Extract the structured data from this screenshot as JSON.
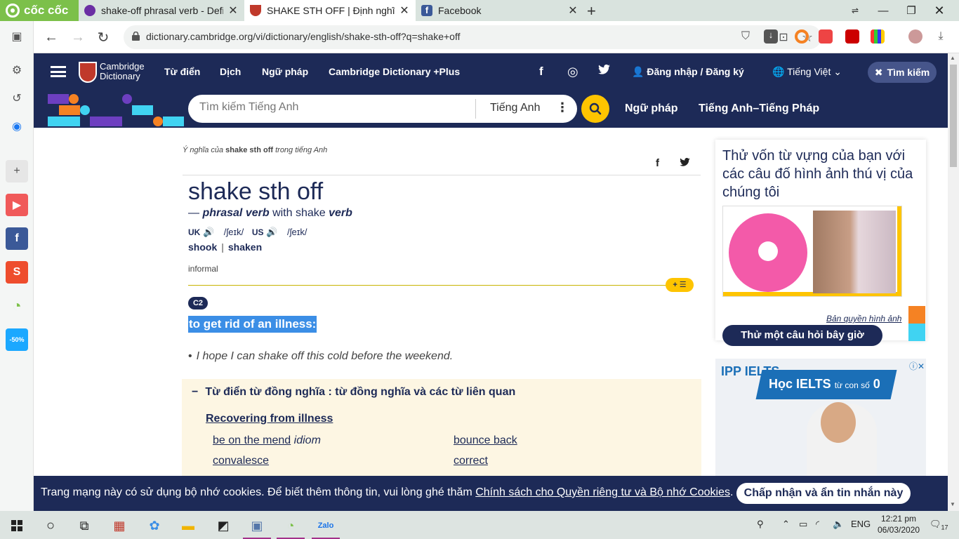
{
  "browser": {
    "brand": "cốc cốc",
    "tabs": [
      {
        "label": "shake-off phrasal verb - Defin",
        "icon": "purple-circle-icon",
        "color": "#6b2ea3"
      },
      {
        "label": "SHAKE STH OFF | Định nghĩa",
        "icon": "cambridge-crest-icon",
        "color": "#c0392b"
      },
      {
        "label": "Facebook",
        "icon": "facebook-icon",
        "color": "#3b5998"
      }
    ],
    "new_tab": "+",
    "url": "dictionary.cambridge.org/vi/dictionary/english/shake-sth-off?q=shake+off"
  },
  "site": {
    "brand_line1": "Cambridge",
    "brand_line2": "Dictionary",
    "nav": [
      "Từ điển",
      "Dịch",
      "Ngữ pháp",
      "Cambridge Dictionary +Plus"
    ],
    "social": {
      "facebook": "f",
      "instagram": "◎",
      "twitter": "🐦"
    },
    "login": "Đăng nhập / Đăng ký",
    "language": "Tiếng Việt",
    "close_search": "Tìm kiếm",
    "search_placeholder": "Tìm kiếm Tiếng Anh",
    "search_lang": "Tiếng Anh",
    "subnav": [
      "Ngữ pháp",
      "Tiếng Anh–Tiếng Pháp"
    ]
  },
  "entry": {
    "breadcrumb_prefix": "Ý nghĩa của",
    "breadcrumb_word": "shake sth off",
    "breadcrumb_suffix": "trong tiếng Anh",
    "headword": "shake sth off",
    "pos_dash": "—",
    "pos": "phrasal verb",
    "pos_with": "with shake",
    "pos_verb": "verb",
    "uk_label": "UK",
    "uk_ipa": "/ʃeɪk/",
    "us_label": "US",
    "us_ipa": "/ʃeɪk/",
    "form1": "shook",
    "form_sep": "|",
    "form2": "shaken",
    "register": "informal",
    "plus_label": "+ ☰",
    "level": "C2",
    "definition": "to get rid of an illness:",
    "example": "I hope I can shake off this cold before the weekend."
  },
  "thesaurus": {
    "title": "Từ điển từ đồng nghĩa : từ đồng nghĩa và các từ liên quan",
    "subtitle": "Recovering from illness",
    "items": [
      {
        "word": "be on the mend",
        "tag": "idiom"
      },
      {
        "word": "bounce back",
        "tag": ""
      },
      {
        "word": "convalesce",
        "tag": ""
      },
      {
        "word": "correct",
        "tag": ""
      }
    ]
  },
  "sidebar_card": {
    "title": "Thử vốn từ vựng của bạn với các câu đố hình ảnh thú vị của chúng tôi",
    "copyright": "Bản quyền hình ảnh",
    "button": "Thử một câu hỏi bây giờ"
  },
  "ad": {
    "brand": "IPP IELTS",
    "headline": "Học IELTS",
    "headline_small": "từ con số",
    "headline_num": "0"
  },
  "cookie": {
    "text": "Trang mạng này có sử dụng bộ nhớ cookies. Để biết thêm thông tin, vui lòng ghé thăm",
    "link": "Chính sách cho Quyền riêng tư và Bộ nhớ Cookies",
    "period": ".",
    "button": "Chấp nhận và ẩn tin nhắn này"
  },
  "taskbar": {
    "lang": "ENG",
    "time": "12:21 pm",
    "date": "06/03/2020",
    "notifications": "17"
  },
  "colors": {
    "navy": "#1d2a57",
    "yellow": "#fec400",
    "highlight": "#3b8ee6",
    "coccoc_green": "#7cc04a"
  }
}
